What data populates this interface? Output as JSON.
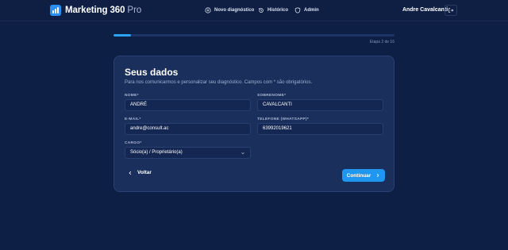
{
  "header": {
    "brand_name": "Marketing 360",
    "brand_suffix": "Pro",
    "nav": [
      {
        "label": "Novo diagnóstico",
        "icon": "plus-circle-icon"
      },
      {
        "label": "Histórico",
        "icon": "history-icon"
      },
      {
        "label": "Admin",
        "icon": "shield-icon"
      }
    ],
    "user_name": "Andre Cavalcanti",
    "logout_icon": "logout-icon"
  },
  "progress": {
    "step_label": "Etapa 2 de 16",
    "current": 2,
    "total": 16,
    "fraction": 0.0625
  },
  "form": {
    "title": "Seus dados",
    "subtitle": "Para nos comunicarmos e personalizar seu diagnóstico. Campos com * são obrigatórios.",
    "fields": {
      "first_name": {
        "label": "NOME*",
        "value": "ANDRÉ"
      },
      "last_name": {
        "label": "SOBRENOME*",
        "value": "CAVALCANTI"
      },
      "email": {
        "label": "E-MAIL*",
        "value": "andre@consult.ac"
      },
      "phone": {
        "label": "TELEFONE (WHATSAPP)*",
        "value": "63992019621"
      },
      "role": {
        "label": "CARGO*",
        "value": "Sócio(a) / Proprietário(a)"
      }
    },
    "back_label": "Voltar",
    "continue_label": "Continuar"
  },
  "colors": {
    "background": "#0e1f45",
    "card": "#1a2f5c",
    "accent": "#1f97f0"
  }
}
